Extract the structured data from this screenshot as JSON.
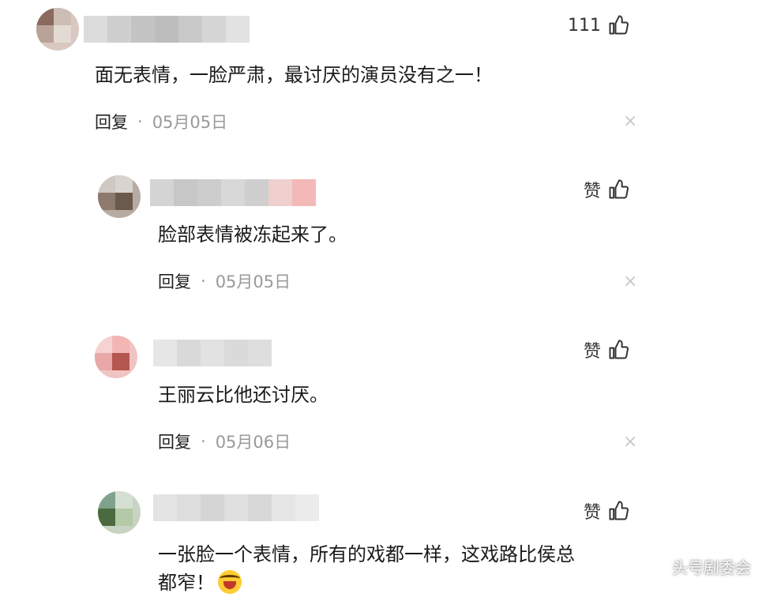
{
  "comments": [
    {
      "likes": "111",
      "text": "面无表情，一脸严肃，最讨厌的演员没有之一！",
      "reply_label": "回复",
      "date": "05月05日"
    },
    {
      "likes": "赞",
      "text": "脸部表情被冻起来了。",
      "reply_label": "回复",
      "date": "05月05日"
    },
    {
      "likes": "赞",
      "text": "王丽云比他还讨厌。",
      "reply_label": "回复",
      "date": "05月06日"
    },
    {
      "likes": "赞",
      "text_line1": "一张脸一个表情，所有的戏都一样，这戏路比侯总",
      "text_line2": "都窄！"
    }
  ],
  "meta_separator": "·",
  "close_glyph": "×",
  "watermark": "头号剧委会",
  "icons": {
    "like": "thumbs-up-icon",
    "close": "close-icon",
    "emoji": "laughing-emoji-icon"
  },
  "colors": {
    "text": "#1a1a1a",
    "date": "#999999",
    "close": "#c8c8c8"
  }
}
